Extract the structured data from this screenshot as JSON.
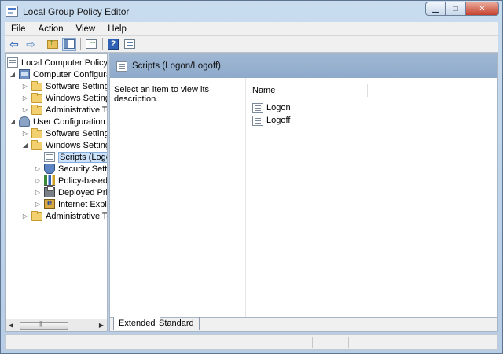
{
  "window": {
    "title": "Local Group Policy Editor",
    "controls": [
      "minimize",
      "maximize",
      "close"
    ]
  },
  "menu": [
    "File",
    "Action",
    "View",
    "Help"
  ],
  "toolbar": {
    "buttons": [
      "back-arrow-icon",
      "forward-arrow-icon",
      "up-folder-icon",
      "show-hide-tree-icon",
      "export-list-icon",
      "help-icon",
      "view-icon"
    ]
  },
  "tree": {
    "items": [
      {
        "label": "Local Computer Policy",
        "icon": "policy-icon",
        "level": 0,
        "expander": ""
      },
      {
        "label": "Computer Configura",
        "icon": "computer-icon",
        "level": 1,
        "expander": "expanded"
      },
      {
        "label": "Software Settings",
        "icon": "folder-icon",
        "level": 2,
        "expander": "collapsed"
      },
      {
        "label": "Windows Setting",
        "icon": "folder-icon",
        "level": 2,
        "expander": "collapsed"
      },
      {
        "label": "Administrative Te",
        "icon": "folder-icon",
        "level": 2,
        "expander": "collapsed"
      },
      {
        "label": "User Configuration",
        "icon": "user-icon",
        "level": 1,
        "expander": "expanded"
      },
      {
        "label": "Software Settings",
        "icon": "folder-icon",
        "level": 2,
        "expander": "collapsed"
      },
      {
        "label": "Windows Setting",
        "icon": "folder-icon",
        "level": 2,
        "expander": "expanded"
      },
      {
        "label": "Scripts (Logon",
        "icon": "scripts-icon",
        "level": 3,
        "expander": "",
        "selected": true
      },
      {
        "label": "Security Settin",
        "icon": "shield-icon",
        "level": 3,
        "expander": "collapsed"
      },
      {
        "label": "Policy-based",
        "icon": "bar-chart-icon",
        "level": 3,
        "expander": "collapsed"
      },
      {
        "label": "Deployed Prin",
        "icon": "printer-icon",
        "level": 3,
        "expander": "collapsed"
      },
      {
        "label": "Internet Explo",
        "icon": "internet-explorer-icon",
        "level": 3,
        "expander": "collapsed"
      },
      {
        "label": "Administrative Te",
        "icon": "folder-icon",
        "level": 2,
        "expander": "collapsed"
      }
    ]
  },
  "right": {
    "header_title": "Scripts (Logon/Logoff)",
    "description": "Select an item to view its description.",
    "column_name": "Name",
    "items": [
      "Logon",
      "Logoff"
    ],
    "tabs": [
      "Extended",
      "Standard"
    ]
  }
}
